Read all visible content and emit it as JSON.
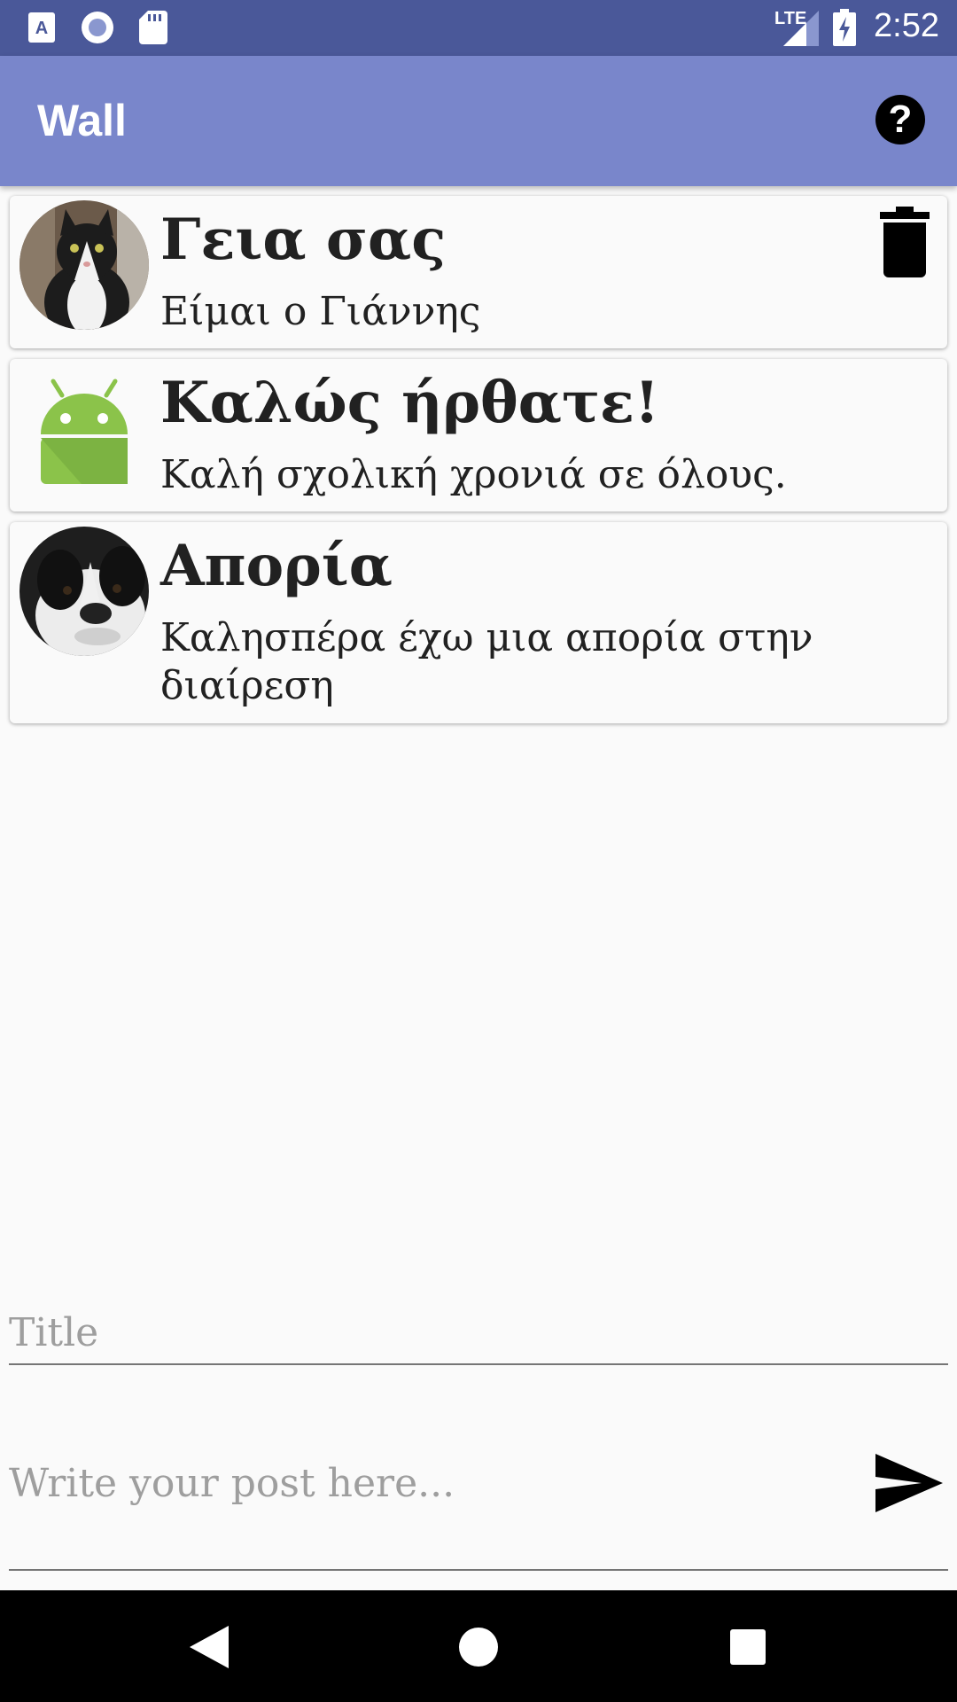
{
  "status_bar": {
    "time": "2:52",
    "network": "LTE",
    "icons": [
      "font-download-icon",
      "record-icon",
      "sd-card-icon",
      "signal-icon",
      "battery-charging-icon"
    ]
  },
  "app_bar": {
    "title": "Wall",
    "help_icon": "help-circle-icon",
    "help_label": "?"
  },
  "posts": [
    {
      "title": "Γεια σας",
      "body": "Είμαι ο Γιάννης",
      "avatar": "cat-photo",
      "deletable": true
    },
    {
      "title": "Καλώς ήρθατε!",
      "body": "Καλή σχολική χρονιά σε όλους.",
      "avatar": "android-icon",
      "deletable": false
    },
    {
      "title": "Απορία",
      "body": "Καλησπέρα έχω μια απορία στην διαίρεση",
      "avatar": "dog-photo",
      "deletable": false
    }
  ],
  "compose": {
    "title_placeholder": "Title",
    "post_placeholder": "Write your post here...",
    "send_icon": "send-icon"
  },
  "nav_bar": {
    "buttons": [
      "back-icon",
      "home-icon",
      "recents-icon"
    ]
  },
  "colors": {
    "status_bar": "#4a5899",
    "app_bar": "#7986cb",
    "android_green": "#8bc34a"
  }
}
